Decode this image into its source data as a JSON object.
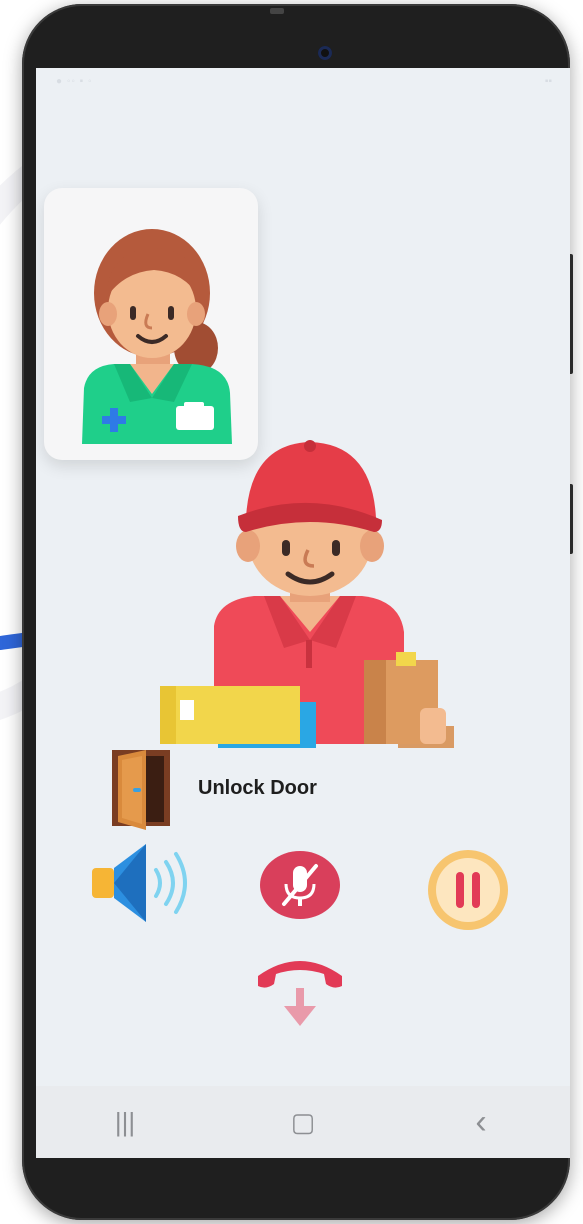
{
  "screen": {
    "unlock_label": "Unlock Door"
  },
  "icons": {
    "caller": "delivery-person-icon",
    "self": "nurse-icon",
    "unlock": "door-icon",
    "speaker": "speaker-icon",
    "mute": "mic-off-icon",
    "hold": "pause-icon",
    "hangup": "hang-up-icon"
  },
  "nav": {
    "recents": "|||",
    "home": "▢",
    "back": "‹"
  },
  "colors": {
    "mute": "#d93f5b",
    "hold_ring": "#f7c56f",
    "hangup": "#e23a56",
    "arrow": "#2f66d9"
  }
}
